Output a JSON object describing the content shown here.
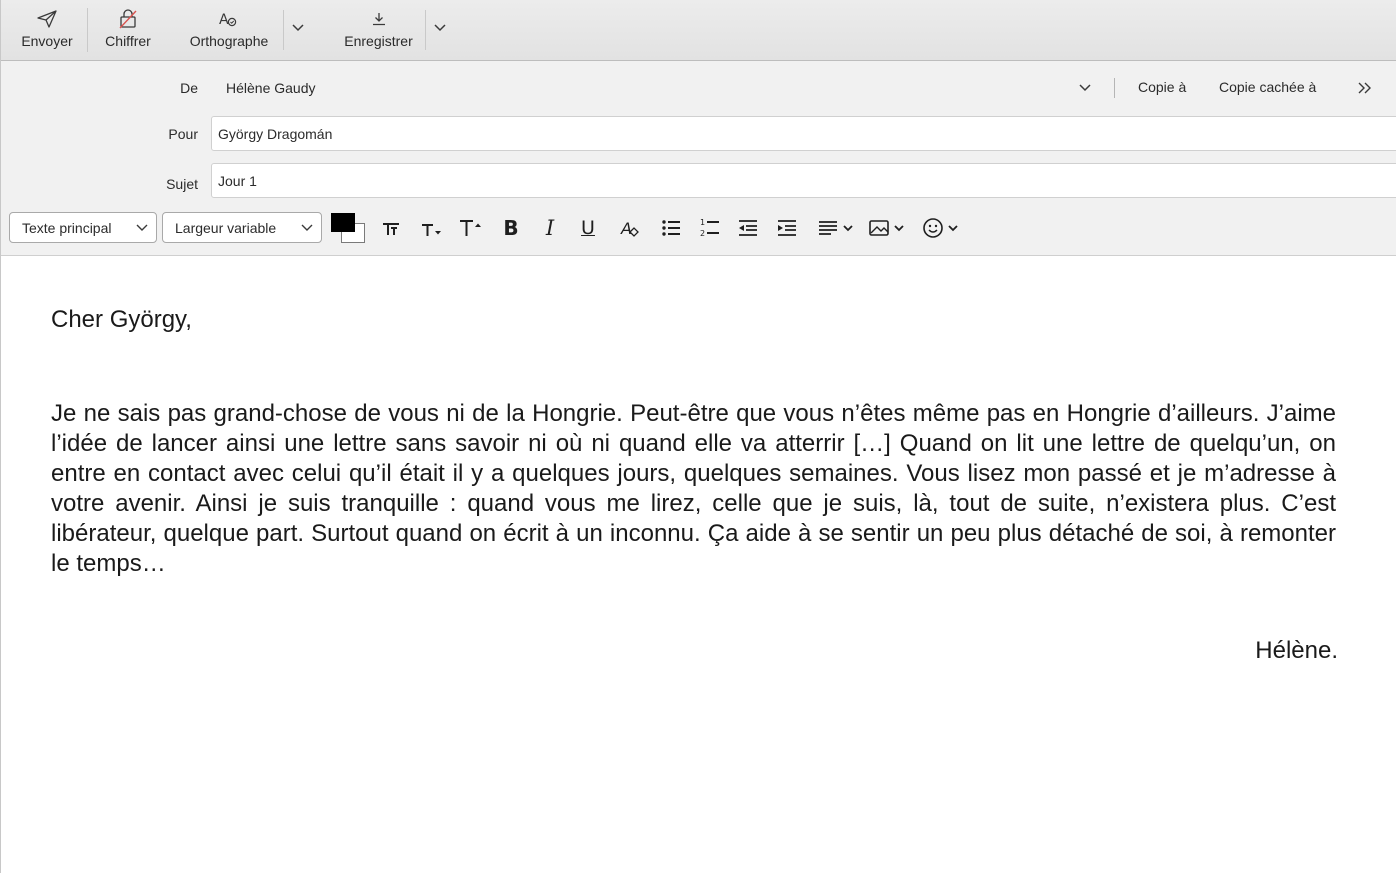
{
  "toolbar": {
    "send_label": "Envoyer",
    "encrypt_label": "Chiffrer",
    "spelling_label": "Orthographe",
    "save_label": "Enregistrer",
    "icons": [
      "send-icon",
      "encrypt-icon",
      "spelling-icon",
      "save-icon",
      "chevron-down-icon"
    ]
  },
  "headers": {
    "from_label": "De",
    "from_value": "Hélène Gaudy",
    "cc_label": "Copie à",
    "bcc_label": "Copie cachée à",
    "to_label": "Pour",
    "to_value": "György Dragomán",
    "subject_label": "Sujet",
    "subject_value": "Jour 1"
  },
  "format_bar": {
    "paragraph_style": "Texte principal",
    "font_width": "Largeur variable",
    "text_color": "#000000",
    "background_color": "#ffffff",
    "icons": [
      "color-picker-icon",
      "font-size-reset-icon",
      "font-smaller-icon",
      "font-larger-icon",
      "bold-icon",
      "italic-icon",
      "underline-icon",
      "clear-formatting-icon",
      "bullet-list-icon",
      "numbered-list-icon",
      "outdent-icon",
      "indent-icon",
      "align-icon",
      "insert-image-icon",
      "emoji-icon"
    ]
  },
  "message": {
    "greeting": "Cher György,",
    "paragraph": "Je ne sais pas grand-chose de vous ni de la Hongrie. Peut-être que vous n’êtes même pas en Hongrie d’ailleurs. J’aime l’idée de lancer ainsi une lettre sans savoir ni où ni quand elle va atterrir […] Quand on lit une lettre de quelqu’un, on entre en contact avec celui qu’il était il y a quelques jours, quelques semaines. Vous lisez mon passé et je m’adresse à votre avenir. Ainsi je suis tranquille : quand vous me lirez, celle que je suis, là, tout de suite, n’existera plus. C’est libérateur, quelque part. Surtout quand on écrit à un inconnu. Ça aide à se sentir un peu plus détaché de soi, à remonter le temps…",
    "signature": "Hélène."
  }
}
